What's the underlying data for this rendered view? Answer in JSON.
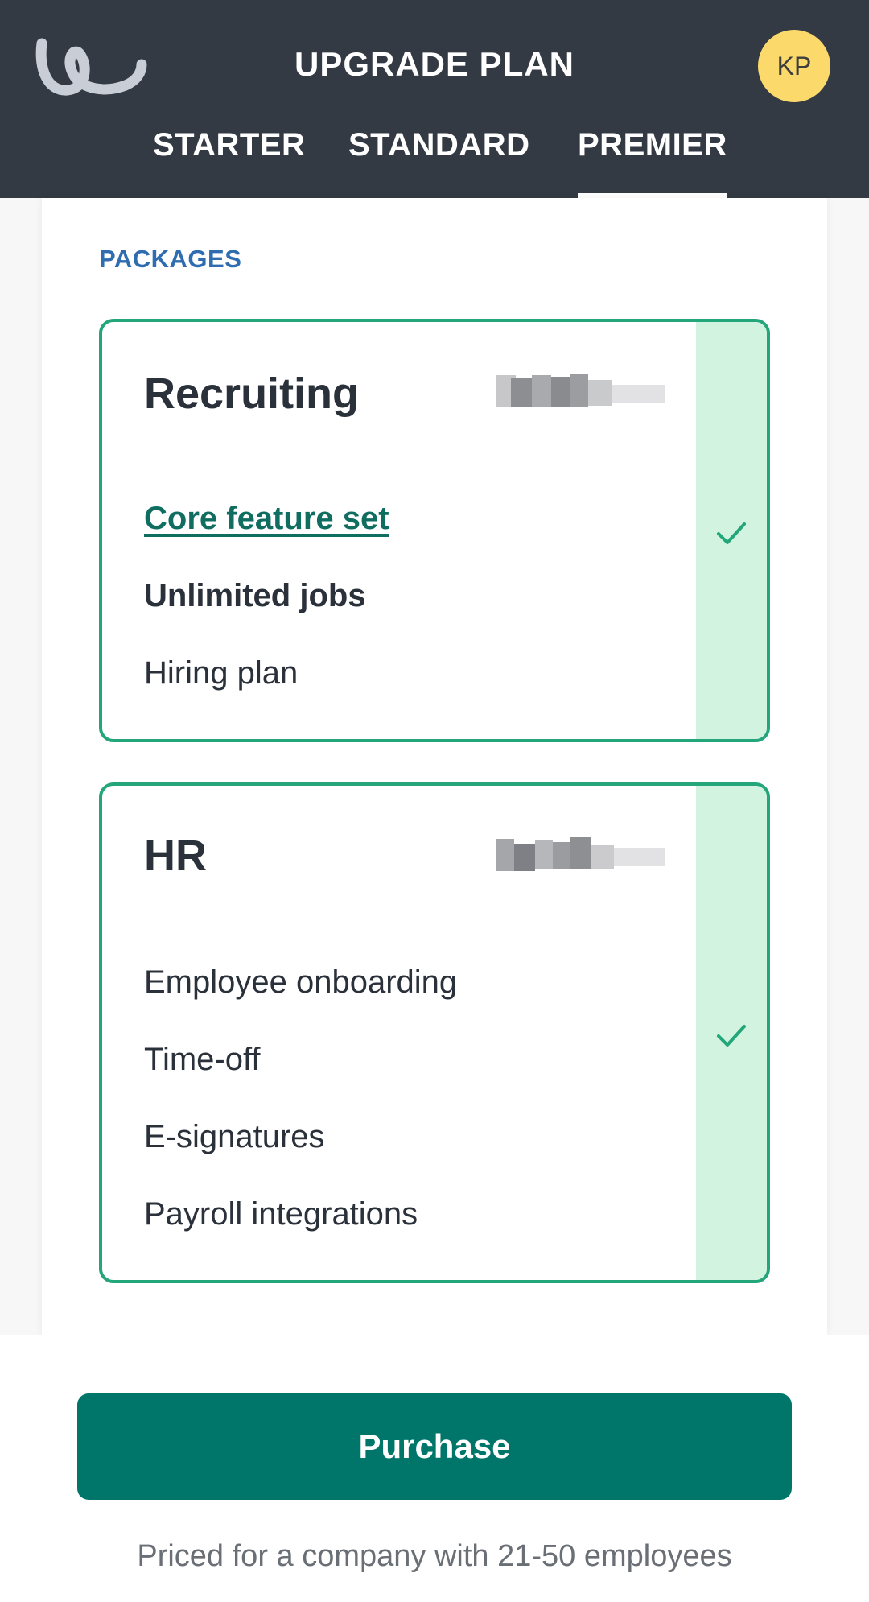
{
  "header": {
    "title": "UPGRADE PLAN",
    "logo_icon": "brand-logo-icon",
    "avatar_initials": "KP",
    "avatar_color": "#fbd96b",
    "tabs": [
      {
        "label": "STARTER",
        "active": false
      },
      {
        "label": "STANDARD",
        "active": false
      },
      {
        "label": "PREMIER",
        "active": true
      }
    ]
  },
  "main": {
    "section_label": "PACKAGES",
    "packages": [
      {
        "name": "Recruiting",
        "price": "blurred",
        "selected": true,
        "features": [
          "Core feature set",
          "Unlimited jobs",
          "Hiring plan"
        ]
      },
      {
        "name": "HR",
        "price": "blurred",
        "selected": true,
        "features": [
          "Employee onboarding",
          "Time-off",
          "E-signatures",
          "Payroll integrations"
        ]
      }
    ]
  },
  "footer": {
    "purchase_label": "Purchase",
    "price_note": "Priced for a company with 21-50 employees"
  },
  "colors": {
    "header_bg": "#333a44",
    "accent_green": "#22a67a",
    "selected_strip": "#d1f3df",
    "button_bg": "#00756a",
    "section_label": "#2f6db0"
  }
}
